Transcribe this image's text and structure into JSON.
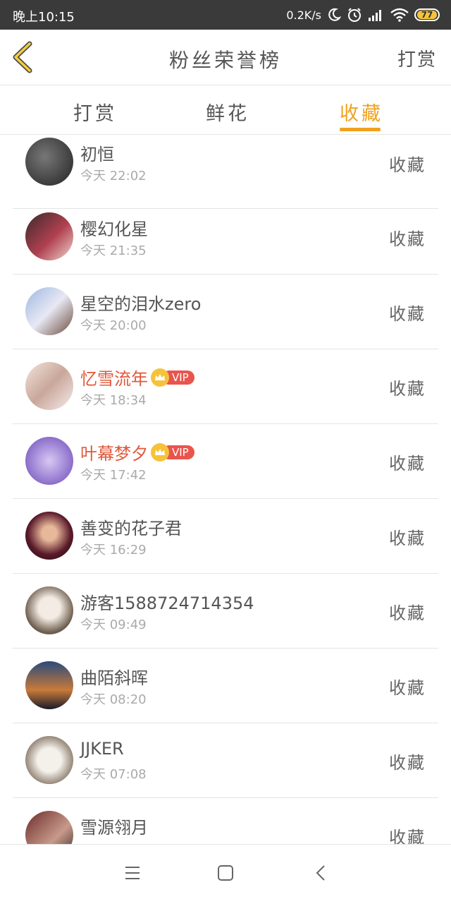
{
  "status_bar": {
    "time": "晚上10:15",
    "net_speed": "0.2K/s",
    "battery": "77",
    "icons": [
      "moon-icon",
      "alarm-icon",
      "signal-icon",
      "wifi-icon",
      "battery-icon"
    ]
  },
  "header": {
    "title": "粉丝荣誉榜",
    "right_action": "打赏"
  },
  "tabs": [
    {
      "label": "打赏",
      "active": false
    },
    {
      "label": "鲜花",
      "active": false
    },
    {
      "label": "收藏",
      "active": true
    }
  ],
  "accent_color": "#f0a11e",
  "vip_badge_label": "VIP",
  "fans": [
    {
      "name": "初恒",
      "time": "今天 22:02",
      "action": "收藏",
      "vip": false
    },
    {
      "name": "樱幻化星",
      "time": "今天 21:35",
      "action": "收藏",
      "vip": false
    },
    {
      "name": "星空的泪水zero",
      "time": "今天 20:00",
      "action": "收藏",
      "vip": false
    },
    {
      "name": "忆雪流年",
      "time": "今天 18:34",
      "action": "收藏",
      "vip": true
    },
    {
      "name": "叶幕梦夕",
      "time": "今天 17:42",
      "action": "收藏",
      "vip": true
    },
    {
      "name": "善变的花子君",
      "time": "今天 16:29",
      "action": "收藏",
      "vip": false
    },
    {
      "name": "游客1588724714354",
      "time": "今天 09:49",
      "action": "收藏",
      "vip": false
    },
    {
      "name": "曲陌斜晖",
      "time": "今天 08:20",
      "action": "收藏",
      "vip": false
    },
    {
      "name": "JJKER",
      "time": "今天 07:08",
      "action": "收藏",
      "vip": false
    },
    {
      "name": "雪源翎月",
      "time": "",
      "action": "收藏",
      "vip": false
    }
  ],
  "nav_bar": [
    "menu-icon",
    "home-icon",
    "back-icon"
  ]
}
